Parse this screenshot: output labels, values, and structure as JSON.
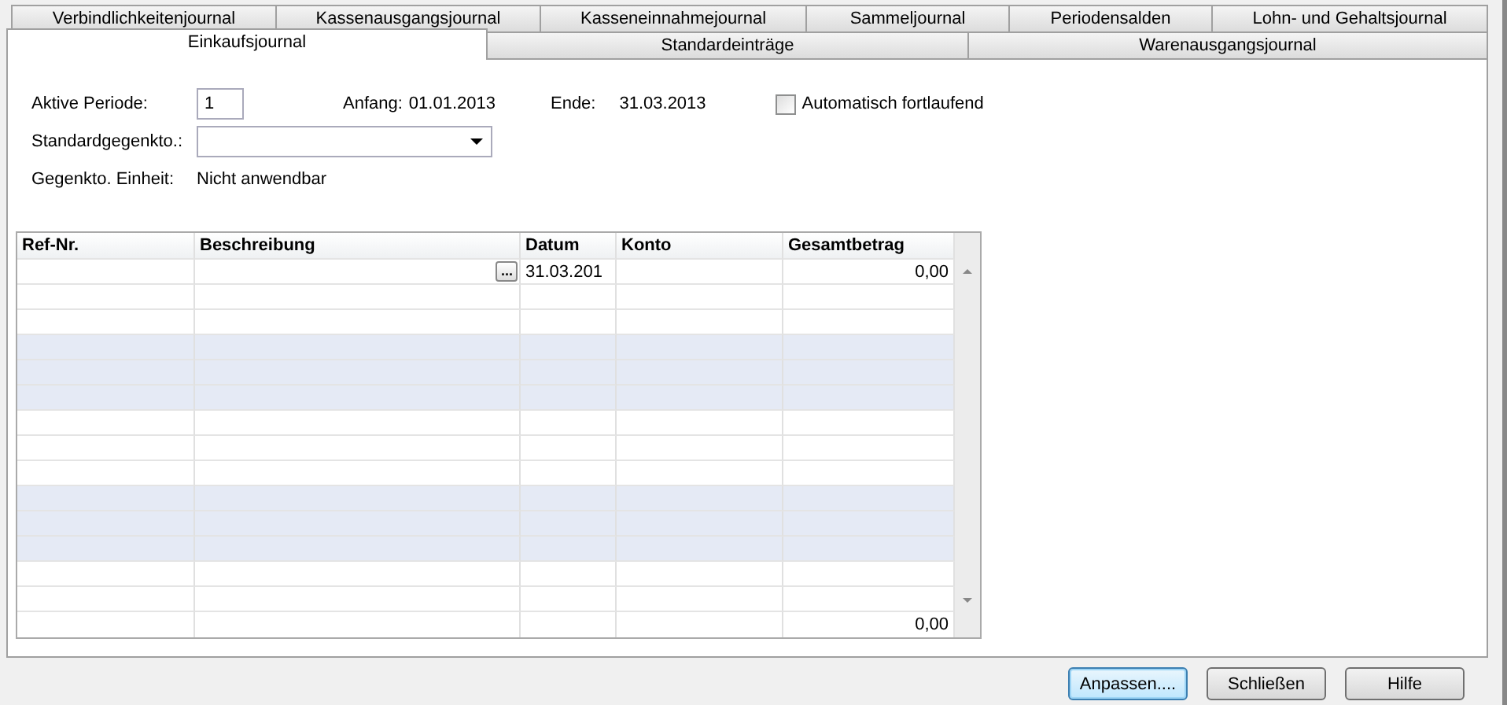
{
  "tabs_row_1": [
    {
      "label": "Verbindlichkeitenjournal",
      "selected": false
    },
    {
      "label": "Kassenausgangsjournal",
      "selected": false
    },
    {
      "label": "Kasseneinnahmejournal",
      "selected": false
    },
    {
      "label": "Sammeljournal",
      "selected": false
    },
    {
      "label": "Periodensalden",
      "selected": false
    },
    {
      "label": "Lohn- und Gehaltsjournal",
      "selected": false
    }
  ],
  "tabs_row_2": [
    {
      "label": "Einkaufsjournal",
      "selected": true
    },
    {
      "label": "Standardeinträge",
      "selected": false
    },
    {
      "label": "Warenausgangsjournal",
      "selected": false
    }
  ],
  "form": {
    "period_label": "Aktive Periode:",
    "period_value": "1",
    "start_label": "Anfang:",
    "start_value": "01.01.2013",
    "end_label": "Ende:",
    "end_value": "31.03.2013",
    "auto_checkbox": {
      "label": "Automatisch fortlaufend",
      "checked": false
    },
    "account_label": "Standardgegenkto.:",
    "unit_label": "Gegenkto. Einheit:",
    "unit_value": "Nicht anwendbar"
  },
  "table": {
    "columns": [
      {
        "label": "Ref-Nr."
      },
      {
        "label": "Beschreibung"
      },
      {
        "label": "Datum"
      },
      {
        "label": "Konto"
      },
      {
        "label": "Gesamtbetrag"
      }
    ],
    "rows": [
      {
        "shaded": false,
        "browse_button": "...",
        "datum": "31.03.201",
        "gesamtbetrag": "0,00"
      },
      {
        "shaded": false
      },
      {
        "shaded": false
      },
      {
        "shaded": true
      },
      {
        "shaded": true
      },
      {
        "shaded": true
      },
      {
        "shaded": false
      },
      {
        "shaded": false
      },
      {
        "shaded": false
      },
      {
        "shaded": true
      },
      {
        "shaded": true
      },
      {
        "shaded": true
      },
      {
        "shaded": false
      },
      {
        "shaded": false
      }
    ],
    "total": {
      "gesamtbetrag": "0,00"
    }
  },
  "buttons": [
    {
      "label": "Anpassen....",
      "focused": true
    },
    {
      "label": "Schließen",
      "focused": false
    },
    {
      "label": "Hilfe",
      "focused": false
    }
  ]
}
